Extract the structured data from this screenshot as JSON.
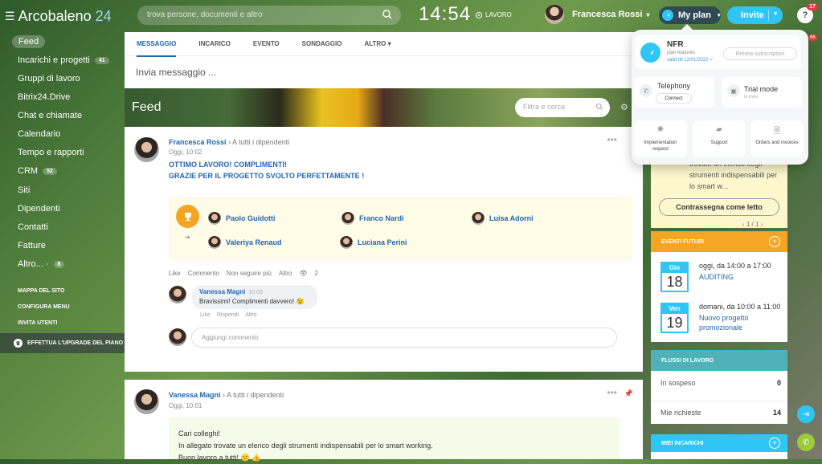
{
  "header": {
    "brand": "Arcobaleno",
    "brand_num": "24",
    "search_placeholder": "trova persone, documenti e altro",
    "clock": "14:54",
    "work_status": "LAVORO",
    "user_name": "Francesca Rossi",
    "my_plan": "My plan",
    "invite": "Invite",
    "help": "?",
    "help_badge": "17"
  },
  "sidebar": {
    "items": [
      {
        "label": "Feed",
        "active": true
      },
      {
        "label": "Incarichi e progetti",
        "badge": "41"
      },
      {
        "label": "Gruppi di lavoro"
      },
      {
        "label": "Bitrix24.Drive"
      },
      {
        "label": "Chat e chiamate"
      },
      {
        "label": "Calendario"
      },
      {
        "label": "Tempo e rapporti"
      },
      {
        "label": "CRM",
        "badge": "52"
      },
      {
        "label": "Siti"
      },
      {
        "label": "Dipendenti"
      },
      {
        "label": "Contatti"
      },
      {
        "label": "Fatture"
      },
      {
        "label": "Altro... ·",
        "badge": "8"
      }
    ],
    "links": [
      "MAPPA DEL SITO",
      "CONFIGURA MENU",
      "INVITA UTENTI"
    ],
    "upgrade": "EFFETTUA L'UPGRADE DEL PIANO"
  },
  "composer": {
    "tabs": [
      "MESSAGGIO",
      "INCARICO",
      "EVENTO",
      "SONDAGGIO",
      "ALTRO ▾"
    ],
    "placeholder": "Invia messaggio ..."
  },
  "feed": {
    "title": "Feed",
    "filter_placeholder": "Filtra e cerca"
  },
  "post1": {
    "author": "Francesca Rossi",
    "to": "A tutti i dipendenti",
    "time": "Oggi, 10:02",
    "line1": "OTTIMO LAVORO! COMPLIMENTI!",
    "line2": "GRAZIE PER IL PROGETTO SVOLTO PERFETTAMENTE !",
    "recipients": [
      "Paolo Guidotti",
      "Franco Nardi",
      "Luisa Adorni",
      "Valeriya Renaud",
      "Luciana Perini"
    ],
    "actions": [
      "Like",
      "Commento",
      "Non seguire più",
      "Altro"
    ],
    "views": "2",
    "comment": {
      "author": "Vanessa Magni",
      "time": "10:03",
      "text": "Bravissimi! Complimenti davvero! 😉",
      "actions": [
        "Like",
        "Rispondi",
        "Altro"
      ]
    },
    "add_comment": "Aggiungi commento"
  },
  "post2": {
    "author": "Vanessa Magni",
    "to": "A tutti i dipendenti",
    "time": "Oggi, 10:01",
    "line1": "Cari colleghi!",
    "line2": "In allegato trovate un elenco degli strumenti indispensabili per lo smart working.",
    "line3": "Buon lavoro a tutti! 🙂 👍"
  },
  "right": {
    "task_text": "trovate un elenco degli strumenti indispensabili per lo smart w...",
    "mark_read": "Contrassegna come letto",
    "task_nav": "‹    1 / 1    ›",
    "events_title": "EVENTI FUTURI",
    "events": [
      {
        "day": "Gio",
        "num": "18",
        "when": "oggi, da 14:00 a 17:00",
        "what": "AUDITING"
      },
      {
        "day": "Ven",
        "num": "19",
        "when": "domani, da 10:00 a 11:00",
        "what": "Nuovo progetto promozionale"
      }
    ],
    "flows_title": "FLUSSI DI LAVORO",
    "flows": [
      {
        "label": "In sospeso",
        "value": "0"
      },
      {
        "label": "Mie richieste",
        "value": "14"
      }
    ],
    "tasks_title": "MIEI INCARICHI"
  },
  "popup": {
    "nfr_title": "NFR",
    "nfr_sub": "plan features",
    "nfr_valid": "valid till 12/01/2022 ✓",
    "renew": "Renew subscription",
    "telephony": "Telephony",
    "connect": "Connect",
    "trial": "Trial mode",
    "trial_sub": "is over",
    "implementation": "Implementation request",
    "support": "Support",
    "orders": "Orders and invoices"
  },
  "edge_badge": "66",
  "colors": {
    "accent": "#2fc6f6",
    "link": "#2067b0",
    "events_header": "#f5a524",
    "flows_header": "#4fb2b9"
  }
}
